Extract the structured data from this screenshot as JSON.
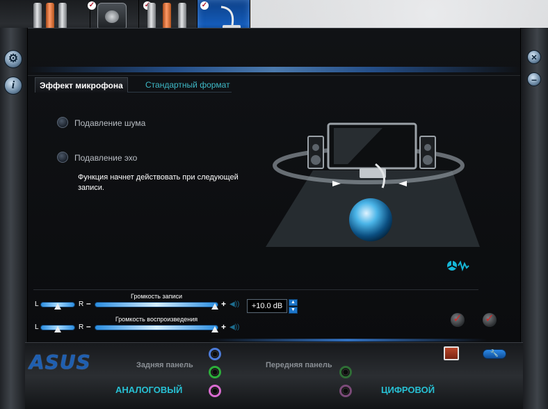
{
  "tabs": {
    "effect_tab": "Эффект микрофона",
    "format_tab": "Стандартный формат"
  },
  "options": {
    "noise": "Подавление шума",
    "echo": "Подавление эхо"
  },
  "note": "Функция начнет действовать при следующей записи.",
  "recording": {
    "title": "Громкость записи",
    "value": "+10.0 dB"
  },
  "playback": {
    "title": "Громкость воспроизведения"
  },
  "labels": {
    "left": "L",
    "right": "R",
    "minus": "–",
    "plus": "+"
  },
  "bottom": {
    "rear_panel": "Задняя панель",
    "front_panel": "Передняя панель",
    "analog": "АНАЛОГОВЫЙ",
    "digital": "ЦИФРОВОЙ",
    "logo": "ASUS"
  },
  "colors": {
    "accent": "#27c0d3",
    "active_tab": "#145bb8"
  }
}
